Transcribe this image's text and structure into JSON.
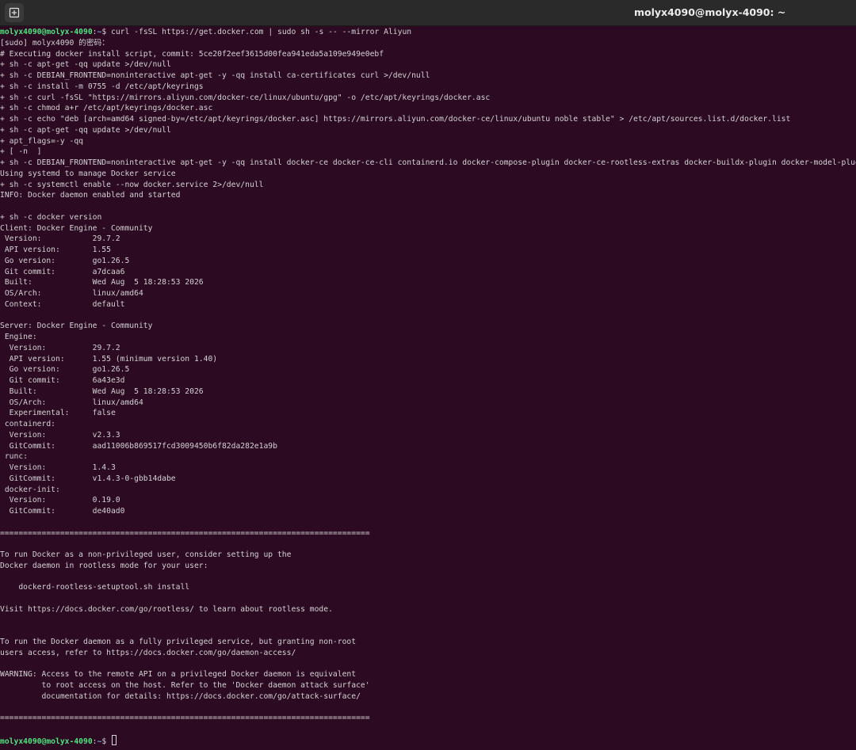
{
  "window": {
    "title": "molyx4090@molyx-4090: ~",
    "new_tab_icon": "new-tab-icon"
  },
  "prompt": {
    "user_host": "molyx4090@molyx-4090",
    "separator": ":",
    "path": "~",
    "symbol": "$"
  },
  "command": " curl -fsSL https://get.docker.com | sudo sh -s -- --mirror Aliyun",
  "output": [
    "[sudo] molyx4090 的密码：",
    "# Executing docker install script, commit: 5ce20f2eef3615d00fea941eda5a109e949e0ebf",
    "+ sh -c apt-get -qq update >/dev/null",
    "+ sh -c DEBIAN_FRONTEND=noninteractive apt-get -y -qq install ca-certificates curl >/dev/null",
    "+ sh -c install -m 0755 -d /etc/apt/keyrings",
    "+ sh -c curl -fsSL \"https://mirrors.aliyun.com/docker-ce/linux/ubuntu/gpg\" -o /etc/apt/keyrings/docker.asc",
    "+ sh -c chmod a+r /etc/apt/keyrings/docker.asc",
    "+ sh -c echo \"deb [arch=amd64 signed-by=/etc/apt/keyrings/docker.asc] https://mirrors.aliyun.com/docker-ce/linux/ubuntu noble stable\" > /etc/apt/sources.list.d/docker.list",
    "+ sh -c apt-get -qq update >/dev/null",
    "+ apt_flags=-y -qq",
    "+ [ -n  ]",
    "+ sh -c DEBIAN_FRONTEND=noninteractive apt-get -y -qq install docker-ce docker-ce-cli containerd.io docker-compose-plugin docker-ce-rootless-extras docker-buildx-plugin docker-model-plugin >/dev/null",
    "Using systemd to manage Docker service",
    "+ sh -c systemctl enable --now docker.service 2>/dev/null",
    "INFO: Docker daemon enabled and started",
    "",
    "+ sh -c docker version",
    "Client: Docker Engine - Community",
    " Version:           29.7.2",
    " API version:       1.55",
    " Go version:        go1.26.5",
    " Git commit:        a7dcaa6",
    " Built:             Wed Aug  5 18:28:53 2026",
    " OS/Arch:           linux/amd64",
    " Context:           default",
    "",
    "Server: Docker Engine - Community",
    " Engine:",
    "  Version:          29.7.2",
    "  API version:      1.55 (minimum version 1.40)",
    "  Go version:       go1.26.5",
    "  Git commit:       6a43e3d",
    "  Built:            Wed Aug  5 18:28:53 2026",
    "  OS/Arch:          linux/amd64",
    "  Experimental:     false",
    " containerd:",
    "  Version:          v2.3.3",
    "  GitCommit:        aad11006b869517fcd3009450b6f82da282e1a9b",
    " runc:",
    "  Version:          1.4.3",
    "  GitCommit:        v1.4.3-0-gbb14dabe",
    " docker-init:",
    "  Version:          0.19.0",
    "  GitCommit:        de40ad0",
    "",
    "================================================================================",
    "",
    "To run Docker as a non-privileged user, consider setting up the",
    "Docker daemon in rootless mode for your user:",
    "",
    "    dockerd-rootless-setuptool.sh install",
    "",
    "Visit https://docs.docker.com/go/rootless/ to learn about rootless mode.",
    "",
    "",
    "To run the Docker daemon as a fully privileged service, but granting non-root",
    "users access, refer to https://docs.docker.com/go/daemon-access/",
    "",
    "WARNING: Access to the remote API on a privileged Docker daemon is equivalent",
    "         to root access on the host. Refer to the 'Docker daemon attack surface'",
    "         documentation for details: https://docs.docker.com/go/attack-surface/",
    "",
    "================================================================================",
    ""
  ],
  "colors": {
    "background": "#2c0a22",
    "text": "#d3d3d3",
    "prompt_user": "#4ee47f",
    "prompt_path": "#7a9dd8"
  }
}
